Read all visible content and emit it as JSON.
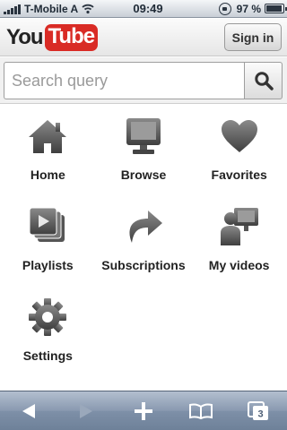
{
  "status_bar": {
    "carrier": "T-Mobile A",
    "time": "09:49",
    "battery": "97 %",
    "battery_level": 0.97
  },
  "header": {
    "logo_you": "You",
    "logo_tube": "Tube",
    "sign_in_label": "Sign in"
  },
  "search": {
    "placeholder": "Search query",
    "value": "",
    "button_icon": "magnifier-icon"
  },
  "menu": {
    "items": [
      {
        "label": "Home",
        "icon": "home-icon"
      },
      {
        "label": "Browse",
        "icon": "monitor-icon"
      },
      {
        "label": "Favorites",
        "icon": "heart-icon"
      },
      {
        "label": "Playlists",
        "icon": "playlist-icon"
      },
      {
        "label": "Subscriptions",
        "icon": "share-arrow-icon"
      },
      {
        "label": "My videos",
        "icon": "user-video-icon"
      },
      {
        "label": "Settings",
        "icon": "gear-icon"
      }
    ]
  },
  "browser_toolbar": {
    "items": [
      {
        "icon": "back-icon"
      },
      {
        "icon": "forward-icon"
      },
      {
        "icon": "add-icon"
      },
      {
        "icon": "bookmarks-icon"
      },
      {
        "icon": "pages-icon",
        "count": "3"
      }
    ]
  },
  "colors": {
    "brand_red": "#d92b25",
    "icon_gray": "#555555",
    "toolbar_blue": "#7e90a8"
  }
}
